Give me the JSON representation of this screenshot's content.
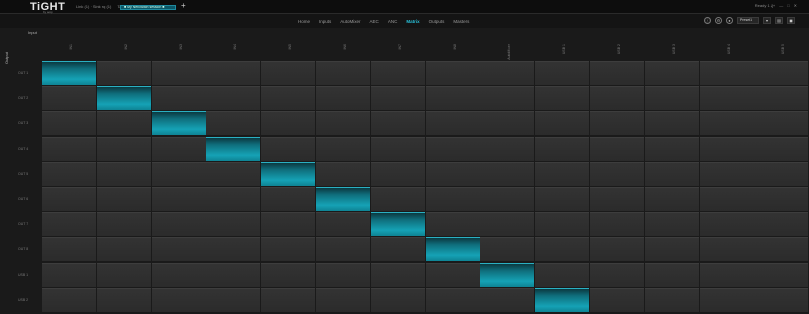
{
  "app": {
    "logo": "TiGHT",
    "logo_sub": "by aoip",
    "status_items": [
      "Link (1) · Sink rq (1)",
      "Tally (0)"
    ],
    "session_tab": "■ My NetSwitch session ■",
    "add_tab": "+",
    "window_controls": [
      "Ready 1 ₰+",
      "—",
      "□",
      "✕"
    ]
  },
  "nav": {
    "tabs": [
      "Home",
      "Inputs",
      "AutoMixer",
      "AEC",
      "ANC",
      "Matrix",
      "Outputs",
      "Masters"
    ],
    "active": "Matrix",
    "info_icon": "ⓘ",
    "settings_icon": "⚙",
    "lock_icon": "●",
    "preset_value": "Preset1",
    "recall_label": "▾",
    "save_label": "▤",
    "exit_label": "◼"
  },
  "matrix": {
    "inputs_label": "Input",
    "outputs_label": "Output",
    "inputs": [
      "IN1",
      "IN2",
      "IN3",
      "IN4",
      "IN5",
      "IN6",
      "IN7",
      "IN8",
      "AutoMixer",
      "USB 1",
      "USB 2",
      "USB 3",
      "USB 4",
      "USB 5"
    ],
    "outputs": [
      "OUT 1",
      "OUT 2",
      "OUT 3",
      "OUT 4",
      "OUT 5",
      "OUT 6",
      "OUT 7",
      "OUT 8",
      "USB 1",
      "USB 2"
    ],
    "routing": [
      [
        1,
        0,
        0,
        0,
        0,
        0,
        0,
        0,
        0,
        0,
        0,
        0,
        0,
        0
      ],
      [
        0,
        1,
        0,
        0,
        0,
        0,
        0,
        0,
        0,
        0,
        0,
        0,
        0,
        0
      ],
      [
        0,
        0,
        1,
        0,
        0,
        0,
        0,
        0,
        0,
        0,
        0,
        0,
        0,
        0
      ],
      [
        0,
        0,
        0,
        1,
        0,
        0,
        0,
        0,
        0,
        0,
        0,
        0,
        0,
        0
      ],
      [
        0,
        0,
        0,
        0,
        1,
        0,
        0,
        0,
        0,
        0,
        0,
        0,
        0,
        0
      ],
      [
        0,
        0,
        0,
        0,
        0,
        1,
        0,
        0,
        0,
        0,
        0,
        0,
        0,
        0
      ],
      [
        0,
        0,
        0,
        0,
        0,
        0,
        1,
        0,
        0,
        0,
        0,
        0,
        0,
        0
      ],
      [
        0,
        0,
        0,
        0,
        0,
        0,
        0,
        1,
        0,
        0,
        0,
        0,
        0,
        0
      ],
      [
        0,
        0,
        0,
        0,
        0,
        0,
        0,
        0,
        1,
        0,
        0,
        0,
        0,
        0
      ],
      [
        0,
        0,
        0,
        0,
        0,
        0,
        0,
        0,
        0,
        1,
        0,
        0,
        0,
        0
      ]
    ]
  }
}
